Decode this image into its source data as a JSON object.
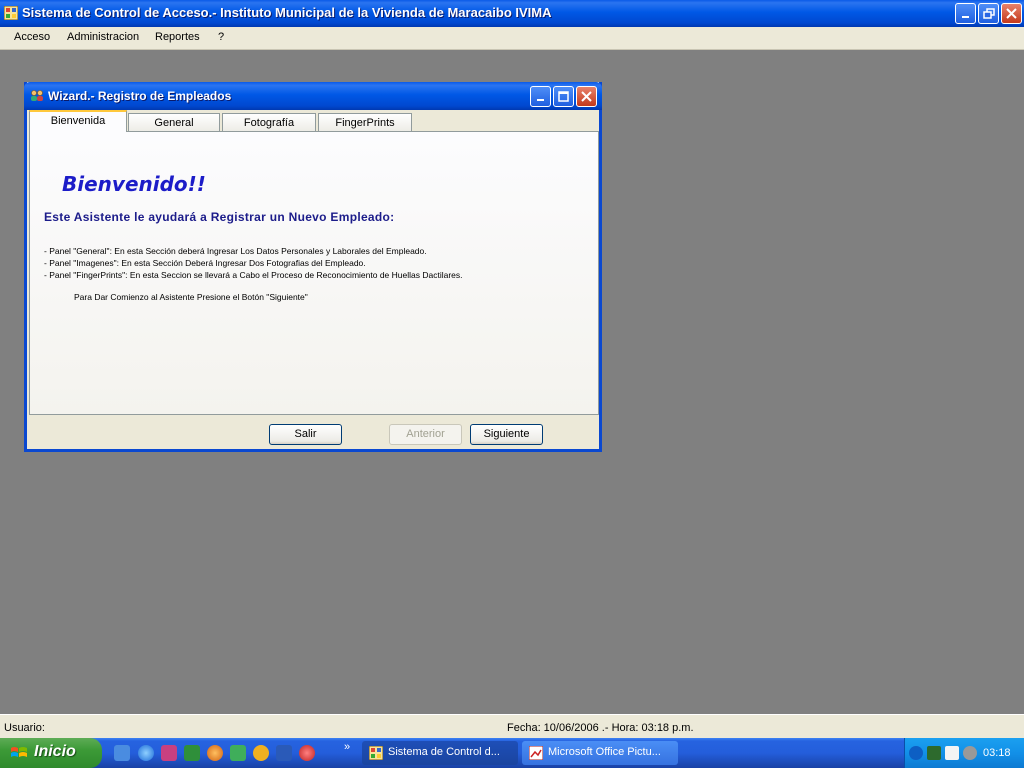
{
  "main_window": {
    "title": "Sistema de Control de Acceso.- Instituto Municipal de la Vivienda de Maracaibo IVIMA"
  },
  "menu": {
    "items": [
      "Acceso",
      "Administracion",
      "Reportes",
      "?"
    ]
  },
  "wizard": {
    "title": "Wizard.- Registro de Empleados",
    "tabs": [
      "Bienvenida",
      "General",
      "Fotografía",
      "FingerPrints"
    ],
    "active_tab": "Bienvenida",
    "heading": "Bienvenido!!",
    "subheading": "Este Asistente le ayudará a Registrar un Nuevo Empleado:",
    "panel_lines": [
      "- Panel \"General\": En esta Sección deberá Ingresar Los Datos Personales y Laborales del Empleado.",
      "- Panel \"Imagenes\": En esta Sección Deberá Ingresar Dos Fotografias del Empleado.",
      "- Panel \"FingerPrints\": En esta Seccion se llevará a Cabo el Proceso de Reconocimiento de Huellas Dactilares."
    ],
    "instruction": "Para Dar Comienzo al Asistente Presione el Botón \"Siguiente\"",
    "buttons": {
      "exit": "Salir",
      "previous": "Anterior",
      "next": "Siguiente"
    }
  },
  "status_bar": {
    "user_label": "Usuario:",
    "datetime": "Fecha: 10/06/2006 .- Hora: 03:18 p.m."
  },
  "taskbar": {
    "start_label": "Inicio",
    "chevron": "»",
    "tasks": [
      "Sistema de Control d...",
      "Microsoft Office Pictu..."
    ],
    "clock": "03:18"
  },
  "colors": {
    "title_blue": "#0058e6",
    "heading_blue": "#1c1cc8",
    "face": "#ece9d8",
    "mdi_gray": "#808080"
  }
}
